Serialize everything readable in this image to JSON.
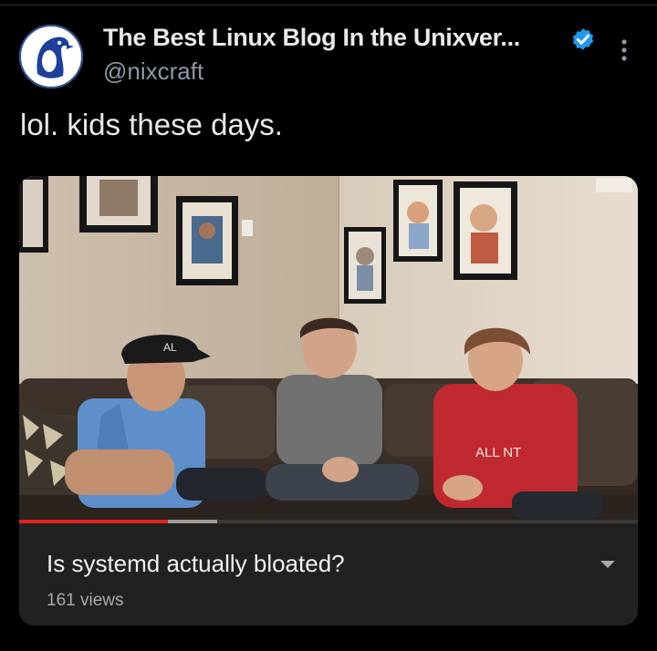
{
  "account": {
    "display_name": "The Best Linux Blog In the Unixver...",
    "handle": "@nixcraft",
    "verified": true,
    "avatar_icon": "penguin-avatar-icon"
  },
  "tweet": {
    "text": "lol. kids these days."
  },
  "video": {
    "title": "Is systemd actually bloated?",
    "views": "161 views",
    "progress": 0.24,
    "buffered": 0.32,
    "progress_color": "#e32222",
    "shirt_text": "ALL NT",
    "cap_text": "AL"
  },
  "icons": {
    "verified": "verified-badge-icon",
    "more": "more-vertical-icon",
    "expand": "chevron-down-icon"
  },
  "colors": {
    "background": "#000000",
    "text": "#e7e9ea",
    "secondary": "#8b98a5",
    "verified": "#1d9bf0",
    "card": "#212121"
  }
}
